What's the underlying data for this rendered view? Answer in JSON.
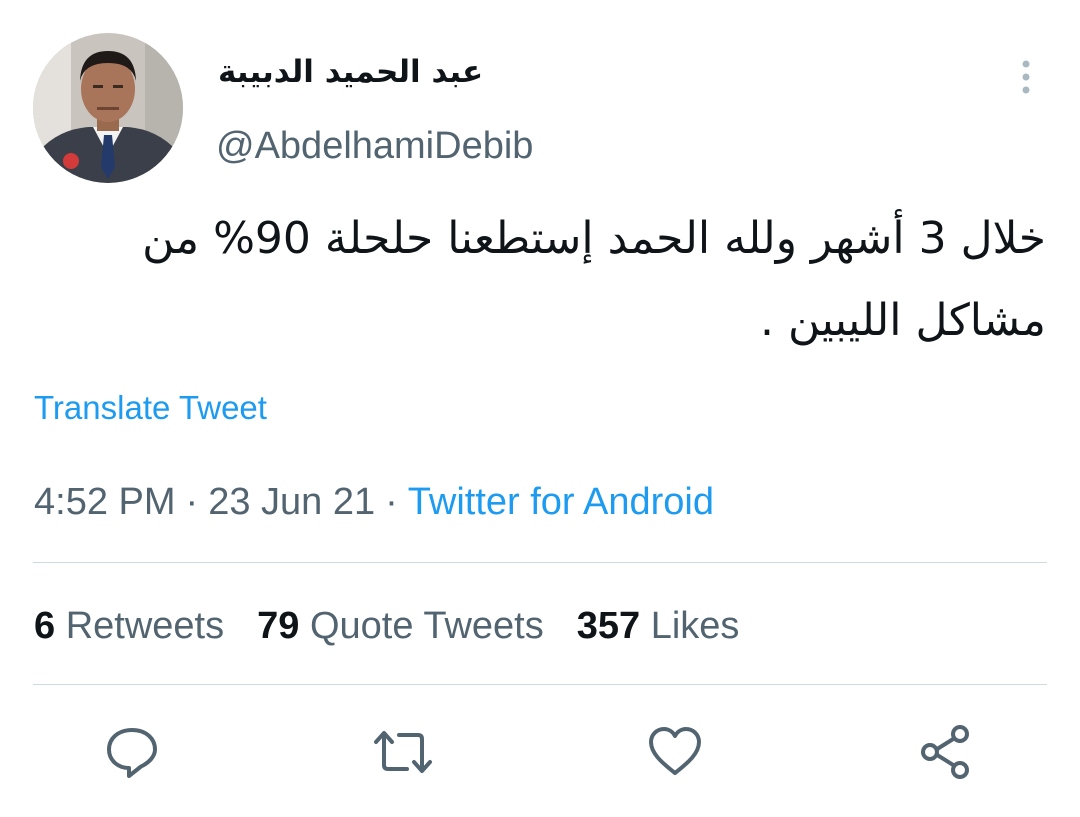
{
  "author": {
    "display_name": "عبد الحميد الدبيبة",
    "handle": "@AbdelhamiDebib",
    "avatar_icon": "profile-photo"
  },
  "tweet": {
    "text": "خلال 3 أشهر ولله الحمد إستطعنا حلحلة 90% من مشاكل الليبين .",
    "translate_label": "Translate Tweet",
    "time": "4:52 PM",
    "date": "23 Jun 21",
    "separator": "·",
    "source": "Twitter for Android"
  },
  "stats": [
    {
      "count": "6",
      "label": "Retweets"
    },
    {
      "count": "79",
      "label": "Quote Tweets"
    },
    {
      "count": "357",
      "label": "Likes"
    }
  ],
  "actions": [
    {
      "icon": "reply-icon"
    },
    {
      "icon": "retweet-icon"
    },
    {
      "icon": "like-icon"
    },
    {
      "icon": "share-icon"
    }
  ],
  "colors": {
    "text_primary": "#0f1419",
    "text_secondary": "#536471",
    "link": "#1d9bf0",
    "divider": "#cfd9de"
  }
}
